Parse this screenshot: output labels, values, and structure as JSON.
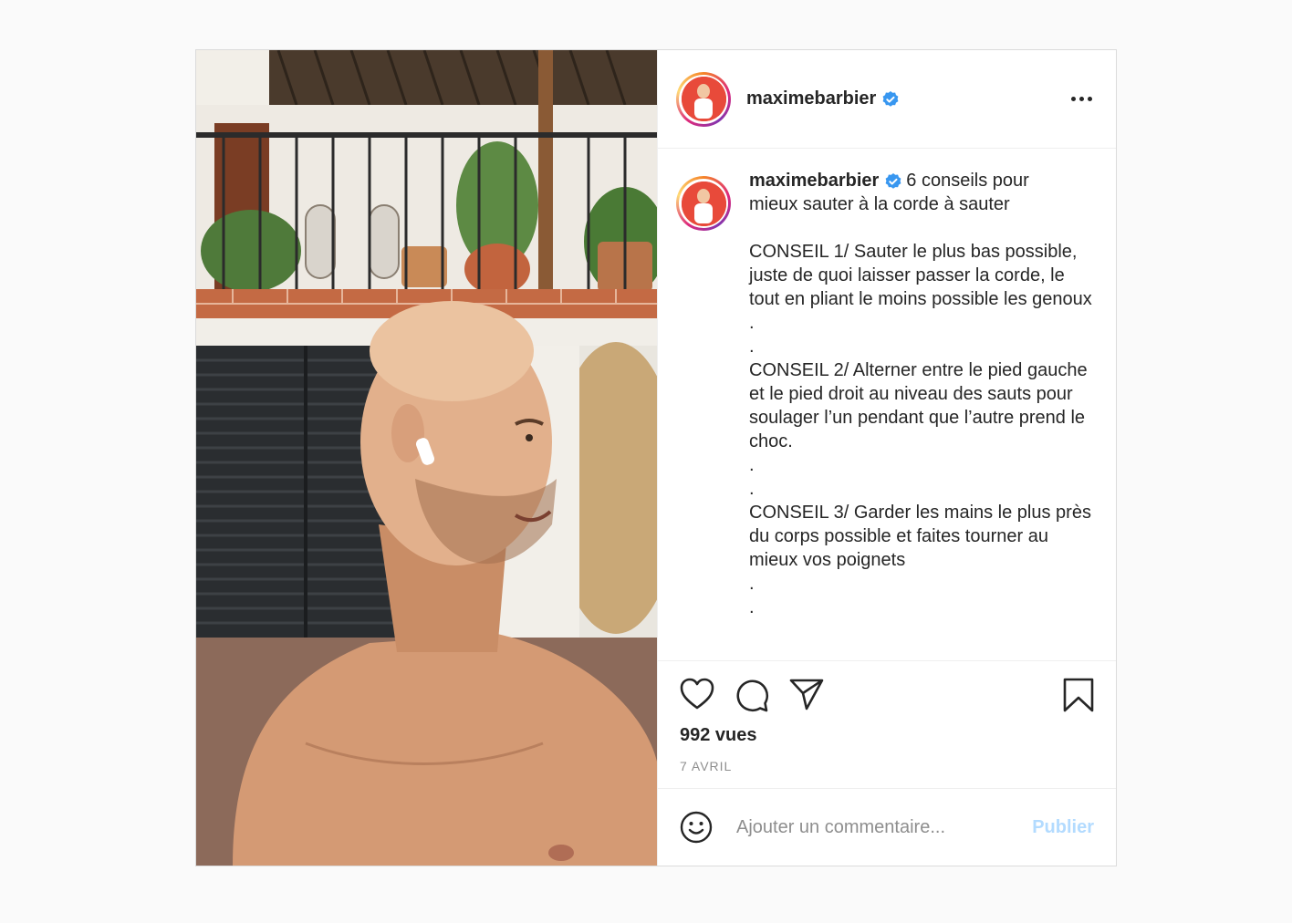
{
  "post": {
    "media": {
      "image_alt": "Shirtless bald man with an earbud smiling in a courtyard"
    },
    "header": {
      "username": "maximebarbier",
      "verified": true
    },
    "caption": {
      "username": "maximebarbier",
      "text": "6 conseils pour\nmieux sauter à la corde à sauter\n\nCONSEIL 1/ Sauter le plus bas possible, juste de quoi laisser passer la corde, le tout en pliant le moins possible les genoux\n.\n.\nCONSEIL 2/ Alterner entre le pied gauche et le pied droit au niveau des sauts pour soulager l’un pendant que l’autre prend le choc.\n.\n.\nCONSEIL 3/ Garder les mains le plus près du corps possible et faites tourner au mieux vos poignets\n.\n."
    },
    "actions": {
      "icons": [
        "heart-icon",
        "comment-icon",
        "share-icon",
        "bookmark-icon"
      ]
    },
    "views": "992 vues",
    "date": "7 AVRIL",
    "comment_box": {
      "placeholder": "Ajouter un commentaire...",
      "publish_label": "Publier"
    },
    "colors": {
      "verified": "#3897f0",
      "publish_disabled": "#b3dbff",
      "text": "#262626",
      "muted": "#8e8e8e"
    }
  }
}
